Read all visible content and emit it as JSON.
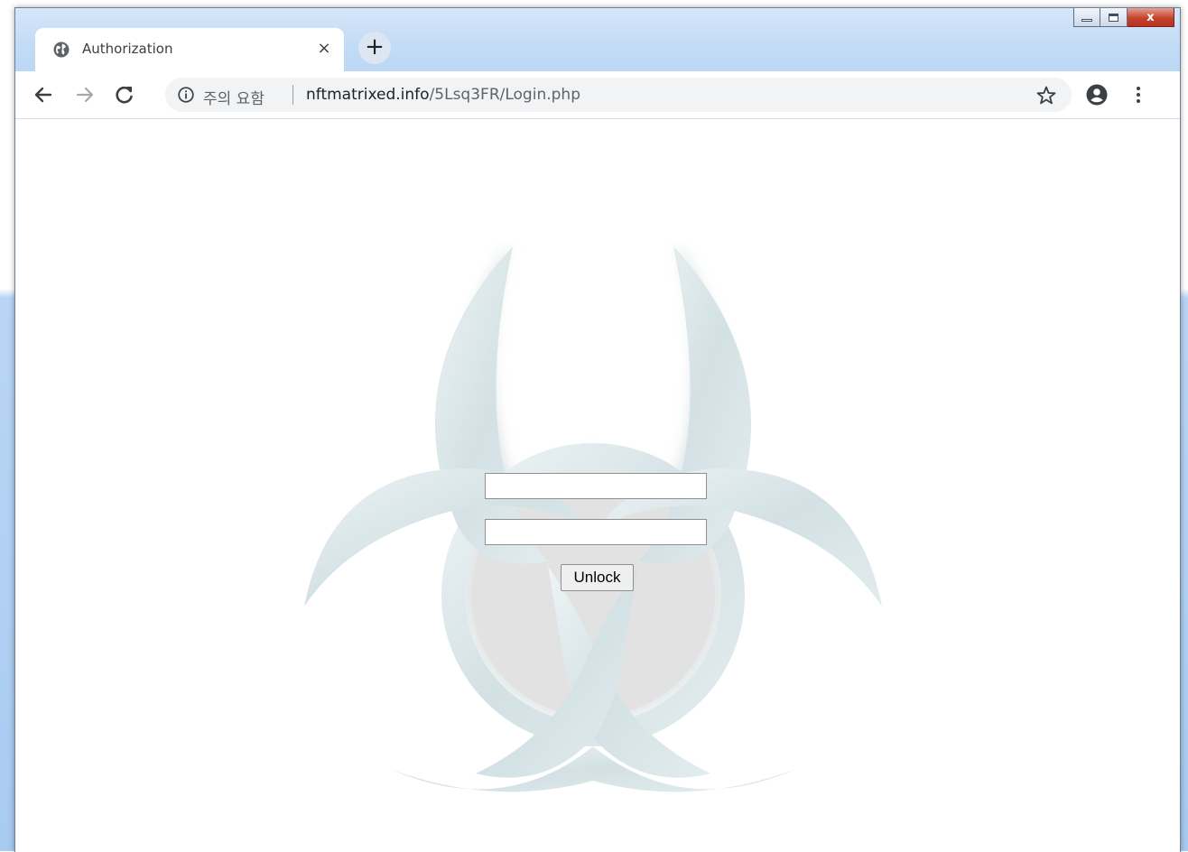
{
  "browser": {
    "tab": {
      "title": "Authorization",
      "favicon": "globe-icon",
      "close_label": "×"
    },
    "new_tab_label": "+",
    "window_controls": {
      "close_label": "x"
    },
    "address_bar": {
      "security_label": "주의 요함",
      "url_host": "nftmatrixed.info",
      "url_path": "/5Lsq3FR/Login.php"
    },
    "icons": {
      "back": "back-arrow-icon",
      "forward": "forward-arrow-icon",
      "reload": "reload-icon",
      "info": "info-icon",
      "bookmark": "star-icon",
      "profile": "profile-icon",
      "menu": "kebab-menu-icon"
    }
  },
  "page": {
    "background_image": "biohazard-symbol",
    "form": {
      "username_value": "",
      "password_value": "",
      "unlock_label": "Unlock"
    }
  },
  "colors": {
    "titlebar": "#c2dbf6",
    "omnibox": "#f1f3f4",
    "close_button": "#c3432e"
  }
}
